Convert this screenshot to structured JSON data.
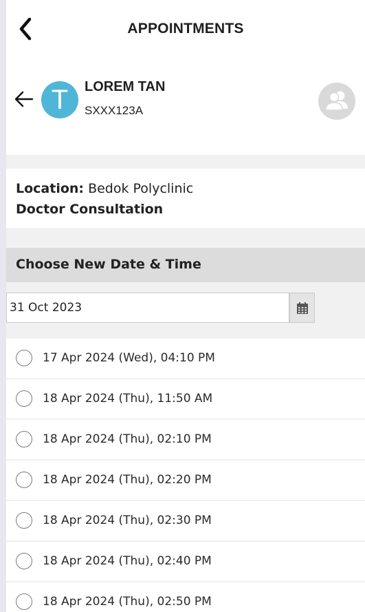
{
  "header": {
    "title": "APPOINTMENTS"
  },
  "patient": {
    "initial": "T",
    "name": "LOREM TAN",
    "id": "SXXX123A"
  },
  "details": {
    "location_label": "Location:",
    "location_value": "Bedok Polyclinic",
    "service": "Doctor Consultation"
  },
  "section": {
    "title": "Choose New Date & Time"
  },
  "date_field": {
    "value": "31 Oct 2023"
  },
  "slots": [
    {
      "label": "17 Apr 2024 (Wed), 04:10 PM"
    },
    {
      "label": "18 Apr 2024 (Thu), 11:50 AM"
    },
    {
      "label": "18 Apr 2024 (Thu), 02:10 PM"
    },
    {
      "label": "18 Apr 2024 (Thu), 02:20 PM"
    },
    {
      "label": "18 Apr 2024 (Thu), 02:30 PM"
    },
    {
      "label": "18 Apr 2024 (Thu), 02:40 PM"
    },
    {
      "label": "18 Apr 2024 (Thu), 02:50 PM"
    }
  ],
  "colors": {
    "avatar": "#4fb6d8",
    "section_header_bg": "#dcdcdc",
    "page_bg": "#f1f1f1"
  },
  "icons": {
    "back": "chevron-left-icon",
    "patient_back": "arrow-left-icon",
    "switch_profile": "people-icon",
    "calendar": "calendar-icon"
  }
}
